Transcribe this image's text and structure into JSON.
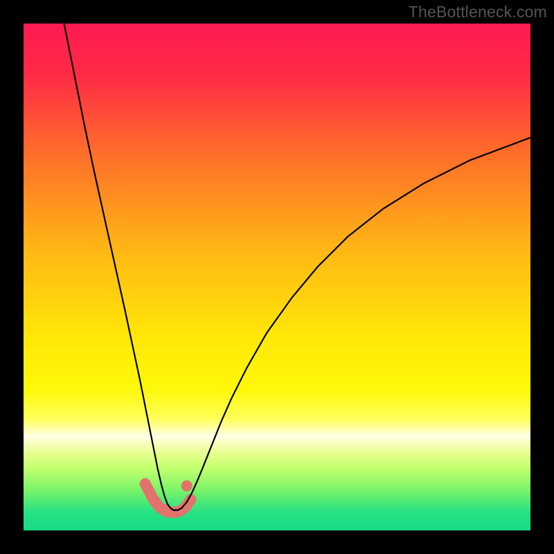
{
  "watermark": "TheBottleneck.com",
  "chart_data": {
    "type": "line",
    "title": "",
    "xlabel": "",
    "ylabel": "",
    "xlim": [
      0,
      100
    ],
    "ylim": [
      0,
      100
    ],
    "grid": false,
    "legend": false,
    "gradient_stops": [
      {
        "offset": 0.0,
        "color": "#ff1a52"
      },
      {
        "offset": 0.1,
        "color": "#ff2a46"
      },
      {
        "offset": 0.25,
        "color": "#ff6b2a"
      },
      {
        "offset": 0.45,
        "color": "#ffb814"
      },
      {
        "offset": 0.62,
        "color": "#ffe807"
      },
      {
        "offset": 0.72,
        "color": "#fff808"
      },
      {
        "offset": 0.78,
        "color": "#ffff5a"
      },
      {
        "offset": 0.8,
        "color": "#ffffad"
      },
      {
        "offset": 0.815,
        "color": "#ffffe8"
      },
      {
        "offset": 0.83,
        "color": "#f7ffb9"
      },
      {
        "offset": 0.85,
        "color": "#e4ff8a"
      },
      {
        "offset": 0.88,
        "color": "#beff6e"
      },
      {
        "offset": 0.92,
        "color": "#7af368"
      },
      {
        "offset": 0.965,
        "color": "#25e183"
      },
      {
        "offset": 1.0,
        "color": "#16db86"
      }
    ],
    "series": [
      {
        "name": "curve",
        "stroke": "#000000",
        "x": [
          8.0,
          10.0,
          12.0,
          14.0,
          16.0,
          18.0,
          20.0,
          21.5,
          23.0,
          24.0,
          25.0,
          25.8,
          26.5,
          27.2,
          27.8,
          28.4,
          29.0,
          29.6,
          30.4,
          31.2,
          32.2,
          33.2,
          34.2,
          35.2,
          37.0,
          39.0,
          41.0,
          44.0,
          48.0,
          53.0,
          58.0,
          64.0,
          71.0,
          79.0,
          88.0,
          100.0
        ],
        "y": [
          100.0,
          90.0,
          80.0,
          70.5,
          61.5,
          52.5,
          43.5,
          36.5,
          29.5,
          24.5,
          19.5,
          15.5,
          12.0,
          9.0,
          6.8,
          5.2,
          4.4,
          4.0,
          4.0,
          4.4,
          5.6,
          7.4,
          9.6,
          12.0,
          16.5,
          21.5,
          26.0,
          32.0,
          39.0,
          46.0,
          52.0,
          58.0,
          63.5,
          68.5,
          73.0,
          77.5
        ]
      }
    ],
    "highlight_path": {
      "stroke": "#e2736c",
      "stroke_width": 16,
      "x": [
        24.0,
        25.5,
        26.8,
        28.0,
        29.0,
        30.0,
        31.0,
        32.0,
        33.0
      ],
      "y": [
        9.2,
        6.3,
        4.6,
        3.8,
        3.6,
        3.6,
        3.9,
        4.7,
        6.1
      ]
    },
    "markers": {
      "fill": "#e2736c",
      "radius": 8,
      "points": [
        {
          "x": 24.0,
          "y": 9.2
        },
        {
          "x": 25.5,
          "y": 6.3
        },
        {
          "x": 27.8,
          "y": 4.1
        },
        {
          "x": 29.0,
          "y": 3.6
        },
        {
          "x": 30.0,
          "y": 3.6
        },
        {
          "x": 32.2,
          "y": 5.0
        },
        {
          "x": 32.2,
          "y": 8.8
        }
      ]
    }
  }
}
